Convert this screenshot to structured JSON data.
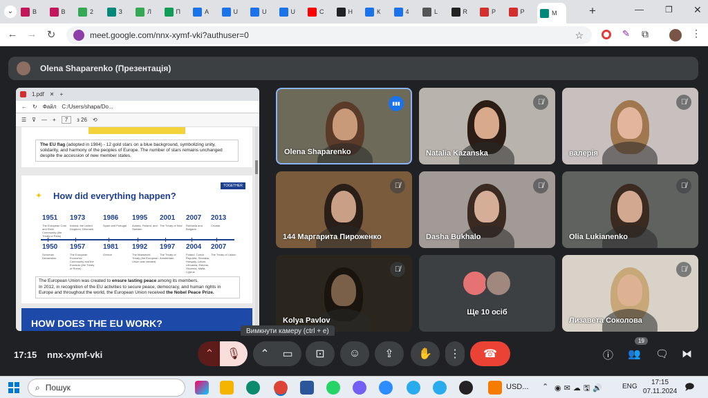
{
  "browser": {
    "tabs": [
      {
        "label": "В",
        "color": "#c2185b"
      },
      {
        "label": "В",
        "color": "#c2185b"
      },
      {
        "label": "2",
        "color": "#34a853"
      },
      {
        "label": "З",
        "color": "#00897b"
      },
      {
        "label": "Л",
        "color": "#34a853"
      },
      {
        "label": "П",
        "color": "#0f9d58"
      },
      {
        "label": "А",
        "color": "#1a73e8"
      },
      {
        "label": "U",
        "color": "#1a73e8"
      },
      {
        "label": "U",
        "color": "#1a73e8"
      },
      {
        "label": "U",
        "color": "#1a73e8"
      },
      {
        "label": "С",
        "color": "#ff0000"
      },
      {
        "label": "Н",
        "color": "#202124"
      },
      {
        "label": "К",
        "color": "#1a73e8"
      },
      {
        "label": "4",
        "color": "#1a73e8"
      },
      {
        "label": "L",
        "color": "#555"
      },
      {
        "label": "R",
        "color": "#222"
      },
      {
        "label": "Р",
        "color": "#d32f2f"
      },
      {
        "label": "Р",
        "color": "#d32f2f"
      },
      {
        "label": "М",
        "color": "#00897b"
      }
    ],
    "url": "meet.google.com/nnx-xymf-vki?authuser=0",
    "add_tab": "+"
  },
  "meeting": {
    "presenter_title": "Olena Shaparenko (Презентація)",
    "time": "17:15",
    "code": "nnx-xymf-vki",
    "tooltip": "Вимкнути камеру (ctrl + e)",
    "participants_count": "19",
    "accent": "#8ab4f8",
    "hangup_color": "#ea4335"
  },
  "presentation": {
    "tab": "1.pdf",
    "addr_label": "Файл",
    "path": "C:/Users/shapa/Do...",
    "page": "7",
    "page_total": "з 26",
    "flag_text_bold": "The EU flag",
    "flag_text": " (adopted in 1984) - 12 gold stars on a blue background, symbolizing unity, solidarity, and harmony of the peoples of Europe. The number of stars remains unchanged despite the accession of new member states.",
    "heading": "How did everything happen?",
    "together": "TOGETHER",
    "timeline_top": [
      {
        "year": "1951",
        "desc": "The European Coal and Steel Community (the Treaty of Paris)"
      },
      {
        "year": "1973",
        "desc": "Ireland, the United Kingdom, Denmark"
      },
      {
        "year": "1986",
        "desc": "Spain and Portugal"
      },
      {
        "year": "1995",
        "desc": "Austria, Finland, and Sweden"
      },
      {
        "year": "2001",
        "desc": "The Treaty of Nice"
      },
      {
        "year": "2007",
        "desc": "Romania and Bulgaria"
      },
      {
        "year": "2013",
        "desc": "Croatia"
      }
    ],
    "timeline_bottom": [
      {
        "year": "1950",
        "desc": "Schuman Declaration"
      },
      {
        "year": "1957",
        "desc": "The European Economic Community and the Euratom (the Treaty of Rome)"
      },
      {
        "year": "1981",
        "desc": "Greece"
      },
      {
        "year": "1992",
        "desc": "The Maastricht Treaty (the European Union was created)"
      },
      {
        "year": "1997",
        "desc": "The Treaty of Amsterdam"
      },
      {
        "year": "2004",
        "desc": "Poland, Czech Republic, Slovakia, Hungary, Latvia, Lithuania, Estonia, Slovenia, Malta, Cyprus"
      },
      {
        "year": "2007",
        "desc": "The Treaty of Lisbon"
      }
    ],
    "peace_text_1": "The European Union was created to ",
    "peace_bold_1": "ensure lasting peace",
    "peace_text_2": " among its members.",
    "peace_text_3": "In 2012, in recognition of the EU activities to secure peace, democracy, and human rights in Europe and throughout the world, the European Union received ",
    "peace_bold_2": "the Nobel Peace Prize.",
    "next_heading": "HOW DOES THE EU WORK?"
  },
  "tiles": [
    {
      "name": "Olena Shaparenko",
      "speaking": true,
      "bg": "#6d6a5a",
      "skin": "#c89a7a",
      "hair": "#5a3a28"
    },
    {
      "name": "Natalia Kazanska",
      "speaking": false,
      "bg": "#b9b3ad",
      "skin": "#d8a98a",
      "hair": "#2b1d16"
    },
    {
      "name": "валерія",
      "speaking": false,
      "bg": "#c7c0bf",
      "skin": "#e2b59c",
      "hair": "#a0774f"
    },
    {
      "name": "144 Маргарита Пироженко",
      "speaking": false,
      "bg": "#7a5b3c",
      "skin": "#c9a085",
      "hair": "#2a1e18"
    },
    {
      "name": "Dasha Bukhalo",
      "speaking": false,
      "bg": "#a29a96",
      "skin": "#d6ae97",
      "hair": "#3a2a22"
    },
    {
      "name": "Olia Lukianenko",
      "speaking": false,
      "bg": "#5f625f",
      "skin": "#d3a890",
      "hair": "#3b2a20"
    },
    {
      "name": "Kolya Pavlov",
      "speaking": false,
      "bg": "#2a261e",
      "skin": "#7a6048",
      "hair": "#1a140e"
    },
    {
      "name": "Ще 10 осіб",
      "speaking": false,
      "bg": "#3c4043",
      "skin": "",
      "hair": ""
    },
    {
      "name": "Лизавета Соколова",
      "speaking": false,
      "bg": "#d8d2c8",
      "skin": "#dcb293",
      "hair": "#c8a878"
    }
  ],
  "taskbar": {
    "search": "Пошук",
    "currency": "USD...",
    "lang": "ENG",
    "time": "17:15",
    "date": "07.11.2024"
  }
}
